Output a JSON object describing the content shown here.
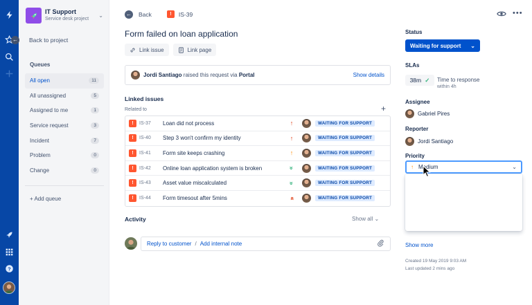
{
  "colors": {
    "nav": "#0747a6",
    "accent": "#0052cc",
    "lozenge_bg": "#deebff",
    "issue_type": "#ff5630"
  },
  "project": {
    "name": "IT Support",
    "type": "Service desk project"
  },
  "sidebar": {
    "back_label": "Back to project",
    "queues_heading": "Queues",
    "queues": [
      {
        "label": "All open",
        "count": "11",
        "active": true
      },
      {
        "label": "All unassigned",
        "count": "5"
      },
      {
        "label": "Assigned to me",
        "count": "1"
      },
      {
        "label": "Service request",
        "count": "3"
      },
      {
        "label": "Incident",
        "count": "7"
      },
      {
        "label": "Problem",
        "count": "0"
      },
      {
        "label": "Change",
        "count": "0"
      }
    ],
    "add_queue": "+ Add queue"
  },
  "topbar": {
    "back_label": "Back",
    "issue_key": "IS-39"
  },
  "issue": {
    "title": "Form failed on loan application",
    "link_issue": "Link issue",
    "link_page": "Link page",
    "raised": {
      "name": "Jordi Santiago",
      "text": " raised this request via ",
      "channel": "Portal",
      "show_details": "Show details"
    }
  },
  "linked": {
    "heading": "Linked issues",
    "relation": "Related to",
    "rows": [
      {
        "key": "IS-37",
        "summary": "Loan did not process",
        "priority": "high",
        "status": "WAITING FOR SUPPORT"
      },
      {
        "key": "IS-40",
        "summary": "Step 3 won't confirm my identity",
        "priority": "high",
        "status": "WAITING FOR SUPPORT"
      },
      {
        "key": "IS-41",
        "summary": "Form site keeps crashing",
        "priority": "medium",
        "status": "WAITING FOR SUPPORT"
      },
      {
        "key": "IS-42",
        "summary": "Online loan application system is broken",
        "priority": "lowest",
        "status": "WAITING FOR SUPPORT"
      },
      {
        "key": "IS-43",
        "summary": "Asset value miscalculated",
        "priority": "lowest",
        "status": "WAITING FOR SUPPORT"
      },
      {
        "key": "IS-44",
        "summary": "Form timesout after 5mins",
        "priority": "highest",
        "status": "WAITING FOR SUPPORT"
      }
    ]
  },
  "activity": {
    "heading": "Activity",
    "show_all": "Show all",
    "reply": "Reply to customer",
    "separator": "/",
    "internal_note": "Add internal note"
  },
  "details": {
    "status_label": "Status",
    "status_value": "Waiting for support",
    "slas_label": "SLAs",
    "sla_time": "38m",
    "sla_name": "Time to response",
    "sla_sub": "within 4h",
    "assignee_label": "Assignee",
    "assignee": "Gabriel Pires",
    "reporter_label": "Reporter",
    "reporter": "Jordi Santiago",
    "priority_label": "Priority",
    "priority_value": "Medium",
    "show_more": "Show more",
    "created": "Created 19 May 2019 9:03 AM",
    "updated": "Last updated 2 mins ago"
  }
}
